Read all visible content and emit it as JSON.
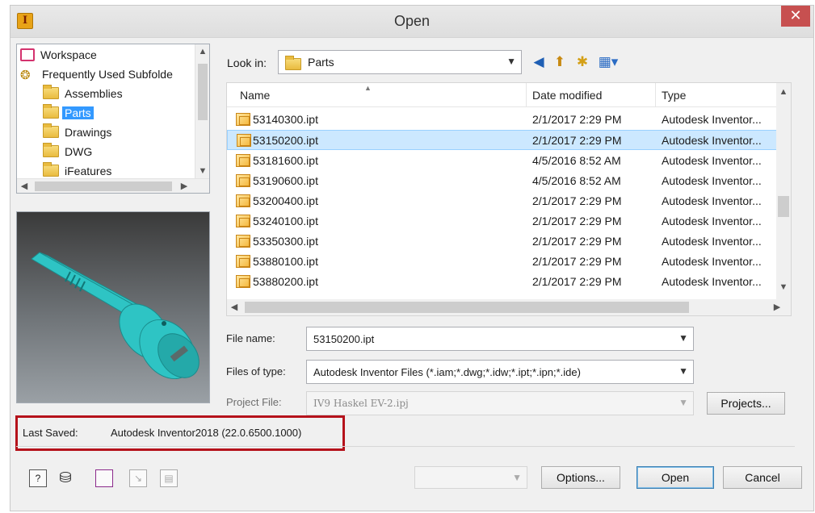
{
  "window": {
    "title": "Open",
    "app_icon_letter": "I",
    "close_glyph": "✕"
  },
  "tree": {
    "items": [
      {
        "label": "Workspace",
        "icon": "workspace-icon"
      },
      {
        "label": "Frequently Used Subfolde",
        "icon": "favorites-icon"
      },
      {
        "label": "Assemblies",
        "icon": "folder-icon"
      },
      {
        "label": "Parts",
        "icon": "folder-icon",
        "selected": true
      },
      {
        "label": "Drawings",
        "icon": "folder-icon"
      },
      {
        "label": "DWG",
        "icon": "folder-icon"
      },
      {
        "label": "iFeatures",
        "icon": "folder-icon"
      }
    ]
  },
  "lookin": {
    "label": "Look in:",
    "value": "Parts"
  },
  "filelist": {
    "columns": [
      "Name",
      "Date modified",
      "Type"
    ],
    "rows": [
      {
        "name": "53140300.ipt",
        "date": "2/1/2017 2:29 PM",
        "type": "Autodesk Inventor..."
      },
      {
        "name": "53150200.ipt",
        "date": "2/1/2017 2:29 PM",
        "type": "Autodesk Inventor...",
        "selected": true
      },
      {
        "name": "53181600.ipt",
        "date": "4/5/2016 8:52 AM",
        "type": "Autodesk Inventor..."
      },
      {
        "name": "53190600.ipt",
        "date": "4/5/2016 8:52 AM",
        "type": "Autodesk Inventor..."
      },
      {
        "name": "53200400.ipt",
        "date": "2/1/2017 2:29 PM",
        "type": "Autodesk Inventor..."
      },
      {
        "name": "53240100.ipt",
        "date": "2/1/2017 2:29 PM",
        "type": "Autodesk Inventor..."
      },
      {
        "name": "53350300.ipt",
        "date": "2/1/2017 2:29 PM",
        "type": "Autodesk Inventor..."
      },
      {
        "name": "53880100.ipt",
        "date": "2/1/2017 2:29 PM",
        "type": "Autodesk Inventor..."
      },
      {
        "name": "53880200.ipt",
        "date": "2/1/2017 2:29 PM",
        "type": "Autodesk Inventor..."
      }
    ]
  },
  "form": {
    "filename_label": "File name:",
    "filename_value": "53150200.ipt",
    "filetype_label": "Files of type:",
    "filetype_value": "Autodesk Inventor Files (*.iam;*.dwg;*.idw;*.ipt;*.ipn;*.ide)",
    "project_label": "Project File:",
    "project_value": "IV9 Haskel EV-2.ipj",
    "projects_button": "Projects..."
  },
  "last_saved": {
    "label": "Last Saved:",
    "value": "Autodesk Inventor2018 (22.0.6500.1000)"
  },
  "buttons": {
    "options": "Options...",
    "open": "Open",
    "cancel": "Cancel"
  },
  "colors": {
    "accent": "#3399ff",
    "selection_row": "#cce8ff",
    "highlight_box": "#b5121b",
    "part_color": "#2ec4c4",
    "close": "#c75050"
  }
}
